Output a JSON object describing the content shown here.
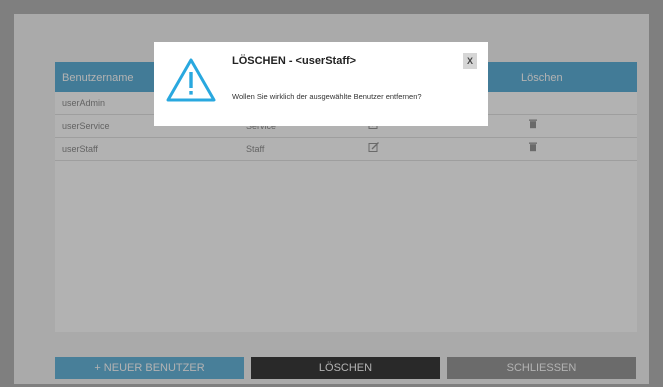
{
  "table": {
    "headers": {
      "username": "Benutzername",
      "delete": "Löschen"
    },
    "rows": [
      {
        "username": "userAdmin",
        "role": ""
      },
      {
        "username": "userService",
        "role": "Service"
      },
      {
        "username": "userStaff",
        "role": "Staff"
      }
    ]
  },
  "buttons": {
    "new_user": "+ NEUER BENUTZER",
    "delete": "LÖSCHEN",
    "close": "SCHLIESSEN"
  },
  "dialog": {
    "title": "LÖSCHEN - <userStaff>",
    "message": "Wollen Sie wirklich der ausgewählte Benutzer entfernen?",
    "close": "X"
  },
  "colors": {
    "accent": "#5fb1d8",
    "dark_button": "#3c3c3c",
    "warning_icon": "#29a8df"
  },
  "icons": {
    "dialog": "warning-icon",
    "edit": "edit-icon",
    "delete": "trash-icon"
  }
}
